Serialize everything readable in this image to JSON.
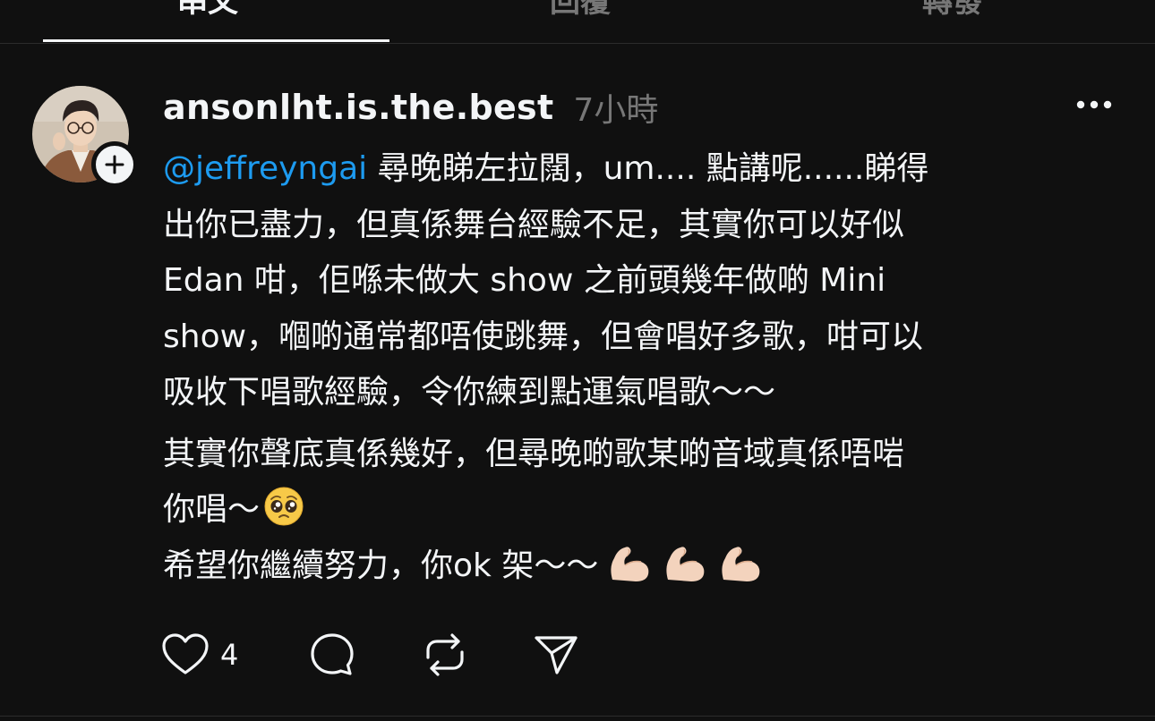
{
  "tabs": [
    {
      "label": "串文",
      "active": true
    },
    {
      "label": "回覆",
      "active": false
    },
    {
      "label": "轉發",
      "active": false
    }
  ],
  "post": {
    "username": "ansonlht.is.the.best",
    "time": "7小時",
    "mention": "@jeffreyngai",
    "lines": [
      " 尋晚睇左拉闊，um.... 點講呢......睇得",
      "出你已盡力，但真係舞台經驗不足，其實你可以好似",
      "Edan 咁，佢喺未做大 show 之前頭幾年做啲 Mini",
      "show，嗰啲通常都唔使跳舞，但會唱好多歌，咁可以",
      "吸收下唱歌經驗，令你練到點運氣唱歌～～",
      "其實你聲底真係幾好，但尋晚啲歌某啲音域真係唔啱",
      "你唱～",
      "希望你繼續努力，你ok 架～～"
    ],
    "like_count": "4"
  },
  "icons": {
    "avatar": "avatar-photo",
    "follow": "plus-icon",
    "more": "more-dots-icon",
    "like": "heart-icon",
    "reply": "comment-icon",
    "repost": "repost-icon",
    "share": "send-icon",
    "pleading": "pleading-face-emoji",
    "muscle": "flexed-biceps-emoji"
  },
  "colors": {
    "background": "#101010",
    "text": "#f3f5f7",
    "secondary": "#777777",
    "mention": "#1d9bf0"
  }
}
